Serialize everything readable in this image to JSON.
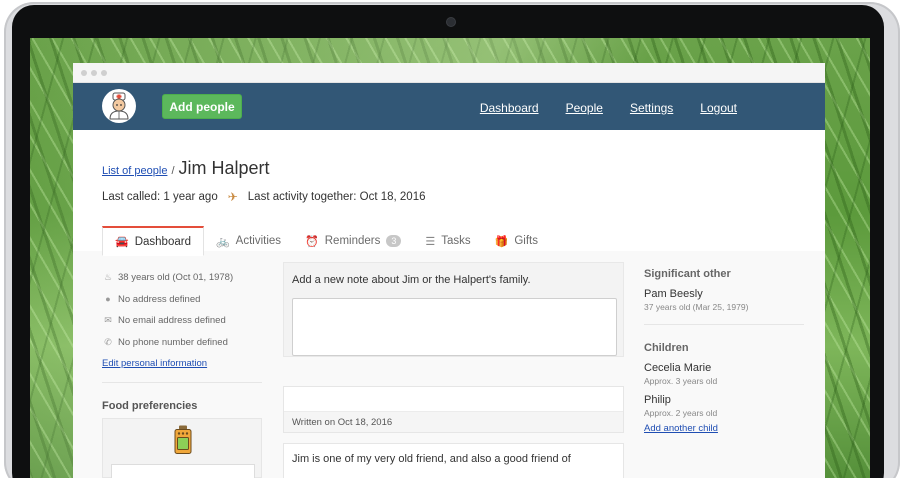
{
  "header": {
    "add_people_label": "Add people",
    "nav": [
      "Dashboard",
      "People",
      "Settings",
      "Logout"
    ]
  },
  "breadcrumb": {
    "list_link": "List of people",
    "separator": "/",
    "person_name": "Jim Halpert"
  },
  "meta": {
    "last_called": "Last called: 1 year ago",
    "last_activity": "Last activity together: Oct 18, 2016"
  },
  "tabs": [
    {
      "label": "Dashboard",
      "icon": "car-icon"
    },
    {
      "label": "Activities",
      "icon": "bike-icon"
    },
    {
      "label": "Reminders",
      "icon": "alarm-icon",
      "badge": "3"
    },
    {
      "label": "Tasks",
      "icon": "list-icon"
    },
    {
      "label": "Gifts",
      "icon": "gift-icon"
    }
  ],
  "personal_info": [
    {
      "icon": "cake-icon",
      "text": "38 years old (Oct 01, 1978)"
    },
    {
      "icon": "globe-icon",
      "text": "No address defined"
    },
    {
      "icon": "envelope-icon",
      "text": "No email address defined"
    },
    {
      "icon": "phone-icon",
      "text": "No phone number defined"
    }
  ],
  "edit_personal_label": "Edit personal information",
  "food_title": "Food preferencies",
  "notes": {
    "prompt": "Add a new note about Jim or the Halpert's family.",
    "written_on": "Written on Oct 18, 2016",
    "note_text": "Jim is one of my very old friend, and also a good friend of"
  },
  "significant_other": {
    "title": "Significant other",
    "name": "Pam Beesly",
    "age": "37 years old (Mar 25, 1979)"
  },
  "children": {
    "title": "Children",
    "items": [
      {
        "name": "Cecelia Marie",
        "age": "Approx. 3 years old"
      },
      {
        "name": "Philip",
        "age": "Approx. 2 years old"
      }
    ],
    "add_label": "Add another child"
  },
  "colors": {
    "header_bg": "#325776",
    "accent_green": "#5cb85c",
    "active_tab_border": "#e44d3a",
    "link": "#1f4eb3"
  }
}
